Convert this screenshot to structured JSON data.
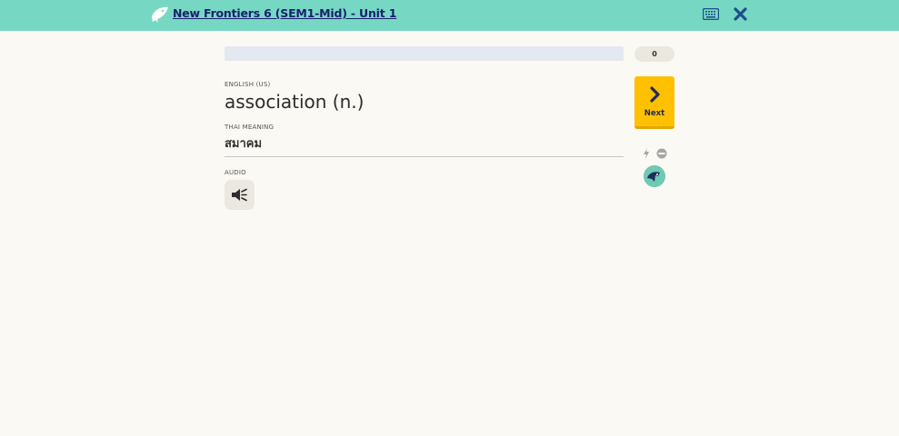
{
  "header": {
    "course_title": "New Frontiers 6 (SEM1-Mid) - Unit 1",
    "icons": {
      "logo": "memrise-logo-icon",
      "keyboard": "keyboard-icon",
      "close": "close-icon"
    },
    "bar_color": "#76d8c3"
  },
  "progress": {
    "fraction": 0.0,
    "score": "0"
  },
  "card": {
    "prompt_label": "ENGLISH (US)",
    "word": "association (n.)",
    "meaning_label": "THAI MEANING",
    "meaning": "สมาคม",
    "audio_label": "AUDIO",
    "audio_icon": "speaker-icon"
  },
  "sidebar": {
    "next_label": "Next",
    "next_color": "#ffc000",
    "icons": [
      "bolt-icon",
      "ignore-icon",
      "avatar"
    ]
  }
}
